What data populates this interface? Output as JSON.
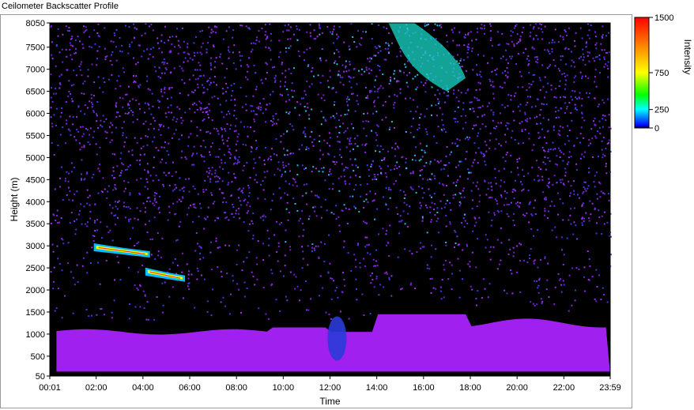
{
  "window": {
    "title": "Ceilometer Backscatter Profile"
  },
  "chart_data": {
    "type": "heatmap",
    "title": "",
    "xlabel": "Time",
    "ylabel": "Height (m)",
    "x_ticks": [
      "00:01",
      "02:00",
      "04:00",
      "06:00",
      "08:00",
      "10:00",
      "12:00",
      "14:00",
      "16:00",
      "18:00",
      "20:00",
      "22:00",
      "23:59"
    ],
    "x_tick_hours": [
      0.0167,
      2,
      4,
      6,
      8,
      10,
      12,
      14,
      16,
      18,
      20,
      22,
      23.983
    ],
    "xlim": [
      0.0167,
      23.983
    ],
    "y_ticks": [
      50,
      500,
      1000,
      1500,
      2000,
      2500,
      3000,
      3500,
      4000,
      4500,
      5000,
      5500,
      6000,
      6500,
      7000,
      7500,
      8050
    ],
    "ylim": [
      50,
      8050
    ],
    "colorbar": {
      "label": "Intensity",
      "ticks": [
        0,
        250,
        750,
        1500
      ],
      "range": [
        0,
        1500
      ],
      "colors": [
        "#000000",
        "#0000ff",
        "#00ffff",
        "#00ff00",
        "#ffff00",
        "#ff8000",
        "#ff0000"
      ]
    },
    "features": [
      {
        "name": "boundary layer aerosol",
        "hour_start": 0.3,
        "hour_end": 23.98,
        "height_top_m": 1100,
        "intensity": 350
      },
      {
        "name": "elevated layer 1",
        "hour_start": 1.9,
        "hour_end": 4.3,
        "height_m": 2900,
        "intensity": 1200
      },
      {
        "name": "elevated layer 2",
        "hour_start": 4.1,
        "hour_end": 5.8,
        "height_m": 2350,
        "intensity": 1100
      },
      {
        "name": "upper plume",
        "hour_start": 14.5,
        "hour_end": 17.8,
        "height_top_m": 8050,
        "height_bottom_m": 6500,
        "intensity": 400
      }
    ]
  }
}
